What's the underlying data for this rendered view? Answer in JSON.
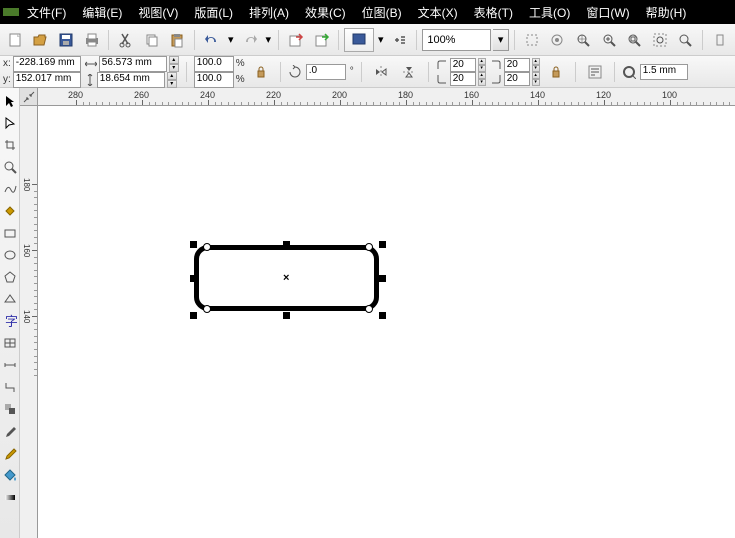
{
  "menu": {
    "file": "文件(F)",
    "edit": "编辑(E)",
    "view": "视图(V)",
    "layout": "版面(L)",
    "arrange": "排列(A)",
    "effects": "效果(C)",
    "bitmap": "位图(B)",
    "text": "文本(X)",
    "table": "表格(T)",
    "tools": "工具(O)",
    "window": "窗口(W)",
    "help": "帮助(H)"
  },
  "toolbar": {
    "zoom": "100%"
  },
  "props": {
    "x_label": "x:",
    "y_label": "y:",
    "x": "-228.169 mm",
    "y": "152.017 mm",
    "w": "56.573 mm",
    "h": "18.654 mm",
    "sx": "100.0",
    "sy": "100.0",
    "pct": "%",
    "rot": ".0",
    "deg": "°",
    "corner1": "20",
    "corner2": "20",
    "corner3": "20",
    "corner4": "20",
    "outline": "1.5 mm"
  },
  "ruler_h": [
    "280",
    "260",
    "240",
    "220",
    "200",
    "180",
    "160",
    "140",
    "120",
    "100"
  ],
  "ruler_v": [
    "180",
    "160",
    "140"
  ]
}
